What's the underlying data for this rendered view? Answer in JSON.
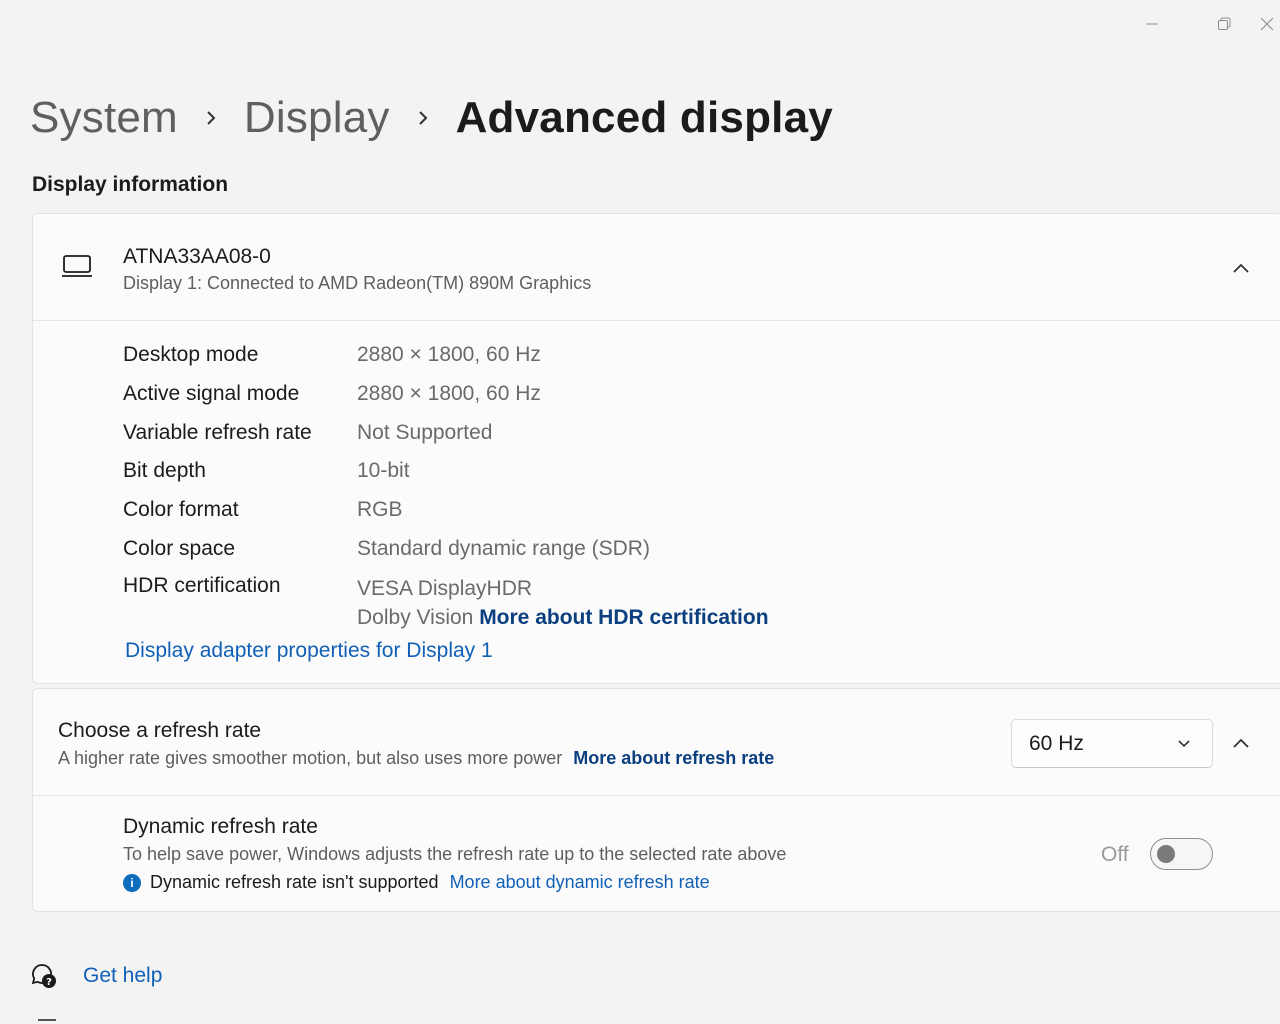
{
  "window": {
    "minimize_icon": "minimize-icon",
    "restore_icon": "restore-icon",
    "close_icon": "close-icon"
  },
  "breadcrumb": {
    "items": [
      "System",
      "Display",
      "Advanced display"
    ]
  },
  "section_title": "Display information",
  "display_card": {
    "device_name": "ATNA33AA08-0",
    "device_subtitle": "Display 1: Connected to AMD Radeon(TM) 890M Graphics",
    "rows": [
      {
        "label": "Desktop mode",
        "value": "2880 × 1800, 60 Hz"
      },
      {
        "label": "Active signal mode",
        "value": "2880 × 1800, 60 Hz"
      },
      {
        "label": "Variable refresh rate",
        "value": "Not Supported"
      },
      {
        "label": "Bit depth",
        "value": "10-bit"
      },
      {
        "label": "Color format",
        "value": "RGB"
      },
      {
        "label": "Color space",
        "value": "Standard dynamic range (SDR)"
      }
    ],
    "hdr": {
      "label": "HDR certification",
      "line1": "VESA DisplayHDR",
      "line2_prefix": "Dolby Vision",
      "link": "More about HDR certification"
    },
    "adapter_link": "Display adapter properties for Display 1"
  },
  "refresh_card": {
    "title": "Choose a refresh rate",
    "subtitle": "A higher rate gives smoother motion, but also uses more power",
    "link": "More about refresh rate",
    "dropdown_value": "60 Hz",
    "dynamic": {
      "title": "Dynamic refresh rate",
      "subtitle": "To help save power, Windows adjusts the refresh rate up to the selected rate above",
      "note": "Dynamic refresh rate isn't supported",
      "note_link": "More about dynamic refresh rate",
      "toggle_label": "Off",
      "toggle_state": false
    }
  },
  "help": {
    "label": "Get help"
  },
  "colors": {
    "accent_link": "#0f4f9a",
    "background": "#f3f3f3",
    "card": "#fbfbfb"
  }
}
